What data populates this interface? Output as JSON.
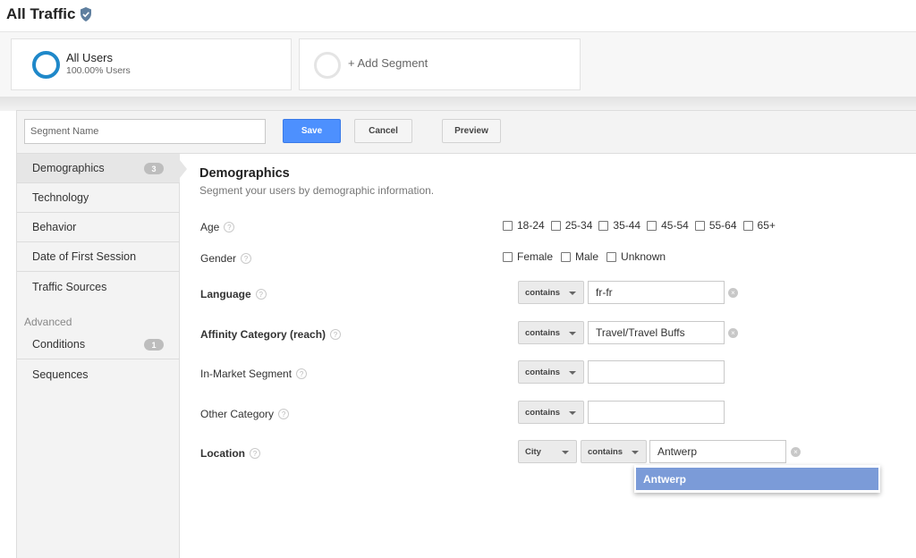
{
  "header": {
    "title": "All Traffic"
  },
  "segments": [
    {
      "name": "All Users",
      "sub": "100.00% Users"
    },
    {
      "name": "+ Add Segment"
    }
  ],
  "toolbar": {
    "segment_name_placeholder": "Segment Name",
    "save_label": "Save",
    "cancel_label": "Cancel",
    "preview_label": "Preview"
  },
  "sidebar": {
    "items": [
      {
        "label": "Demographics",
        "badge": "3"
      },
      {
        "label": "Technology"
      },
      {
        "label": "Behavior"
      },
      {
        "label": "Date of First Session"
      },
      {
        "label": "Traffic Sources"
      }
    ],
    "advanced_heading": "Advanced",
    "advanced_items": [
      {
        "label": "Conditions",
        "badge": "1"
      },
      {
        "label": "Sequences"
      }
    ]
  },
  "main": {
    "title": "Demographics",
    "subtitle": "Segment your users by demographic information.",
    "age": {
      "label": "Age",
      "options": [
        "18-24",
        "25-34",
        "35-44",
        "45-54",
        "55-64",
        "65+"
      ]
    },
    "gender": {
      "label": "Gender",
      "options": [
        "Female",
        "Male",
        "Unknown"
      ]
    },
    "language": {
      "label": "Language",
      "operator": "contains",
      "value": "fr-fr"
    },
    "affinity": {
      "label": "Affinity Category (reach)",
      "operator": "contains",
      "value": "Travel/Travel Buffs"
    },
    "in_market": {
      "label": "In-Market Segment",
      "operator": "contains",
      "value": ""
    },
    "other_category": {
      "label": "Other Category",
      "operator": "contains",
      "value": ""
    },
    "location": {
      "label": "Location",
      "scope": "City",
      "operator": "contains",
      "value": "Antwerp",
      "suggestion": "Antwerp"
    }
  },
  "colors": {
    "accent": "#4d90fe",
    "ring": "#1f88c9",
    "suggestion_bg": "#7b9bd8"
  }
}
